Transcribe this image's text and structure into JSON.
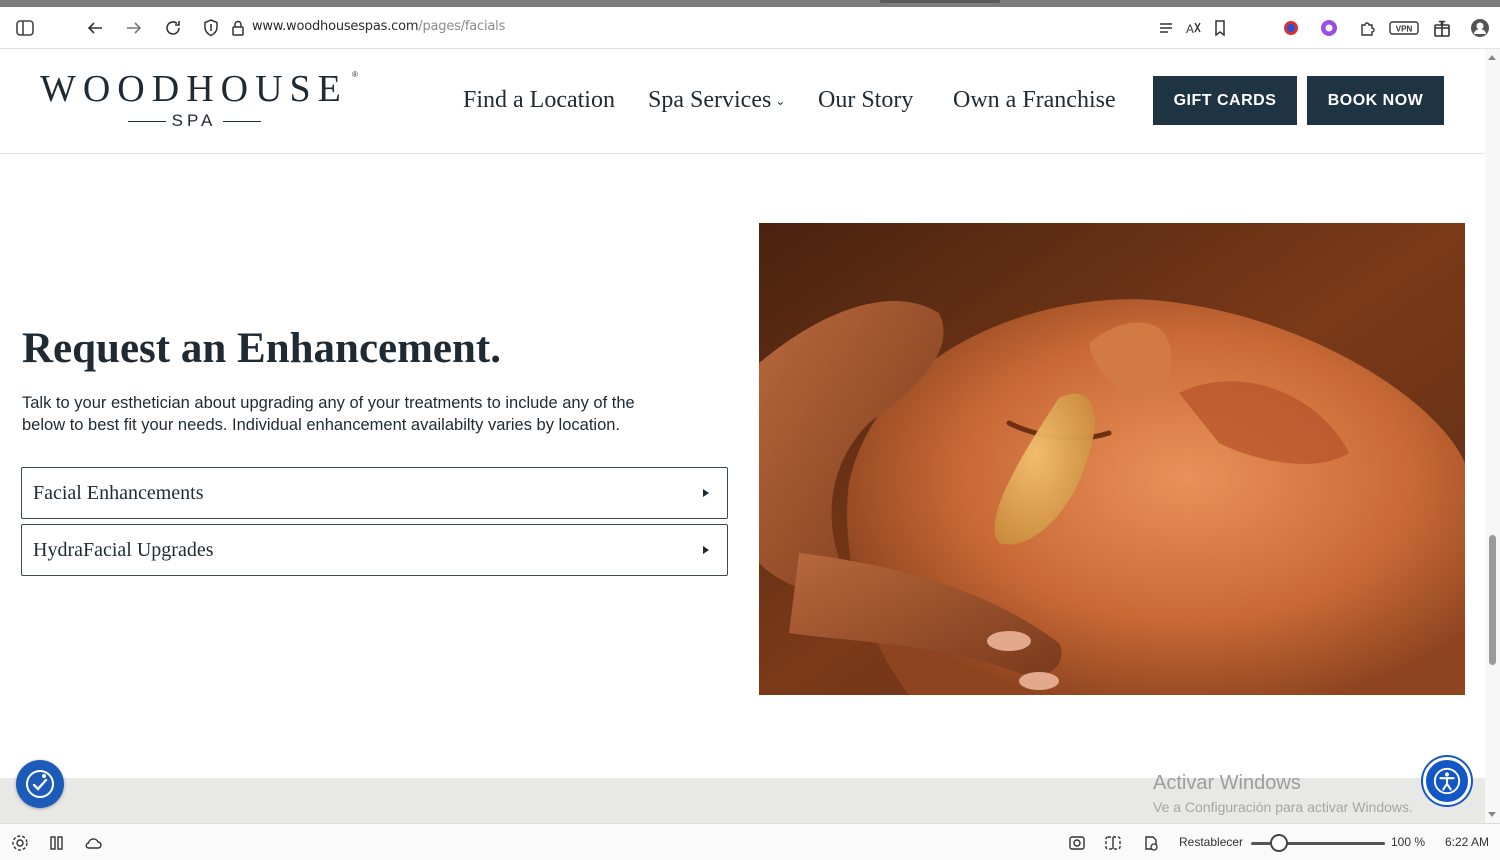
{
  "browser": {
    "url_domain": "www.woodhousespas.com",
    "url_path": "/pages/facials",
    "vpn_label": "VPN"
  },
  "site": {
    "logo_main": "WOODHOUSE",
    "logo_reg": "®",
    "logo_sub": "SPA",
    "nav": {
      "find_location": "Find a Location",
      "spa_services": "Spa Services",
      "our_story": "Our Story",
      "own_franchise": "Own a Franchise"
    },
    "gift_cards": "GIFT CARDS",
    "book_now": "BOOK NOW",
    "brand_color": "#1e3442"
  },
  "main": {
    "title": "Request an Enhancement.",
    "description": "Talk to your esthetician about upgrading any of your treatments to include any of the below to best fit your needs. Individual enhancement availabilty varies by location.",
    "accordions": [
      {
        "label": "Facial Enhancements"
      },
      {
        "label": "HydraFacial Upgrades"
      }
    ]
  },
  "windows": {
    "activate_title": "Activar Windows",
    "activate_sub": "Ve a Configuración para activar Windows."
  },
  "statusbar": {
    "reset_label": "Restablecer",
    "zoom": "100 %",
    "zoom_level": 0.2,
    "time": "6:22 AM"
  }
}
